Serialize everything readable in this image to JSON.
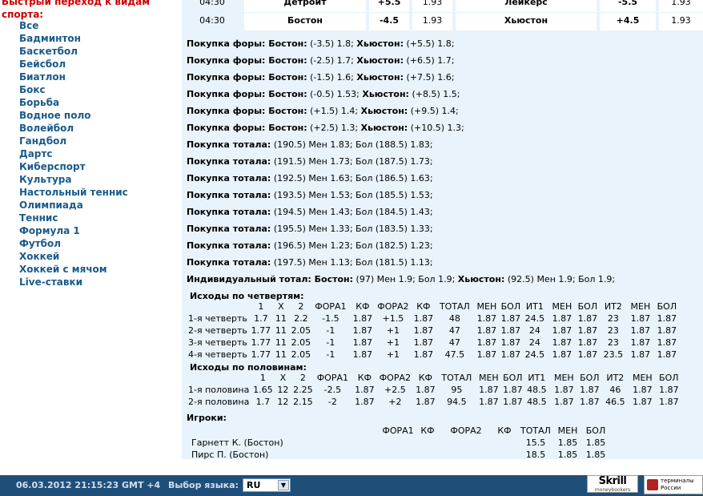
{
  "sidebar": {
    "heading": "Быстрый переход к видам спорта:",
    "items": [
      "Все",
      "Бадминтон",
      "Баскетбол",
      "Бейсбол",
      "Биатлон",
      "Бокс",
      "Борьба",
      "Водное поло",
      "Волейбол",
      "Гандбол",
      "Дартс",
      "Киберспорт",
      "Культура",
      "Настольный теннис",
      "Олимпиада",
      "Теннис",
      "Формула 1",
      "Футбол",
      "Хоккей",
      "Хоккей с мячом",
      "Live-ставки"
    ]
  },
  "matches": [
    {
      "time": "04:30",
      "team1": "Детройт",
      "val1": "+5.5",
      "odd1": "1.93",
      "team2": "Лейкерс",
      "val2": "-5.5",
      "odd2": "1.93"
    },
    {
      "time": "04:30",
      "team1": "Бостон",
      "val1": "-4.5",
      "odd1": "1.93",
      "team2": "Хьюстон",
      "val2": "+4.5",
      "odd2": "1.93"
    }
  ],
  "lines": [
    [
      {
        "b": "Покупка форы: Бостон:"
      },
      {
        "t": " (-3.5) 1.8; "
      },
      {
        "b": "Хьюстон:"
      },
      {
        "t": " (+5.5) 1.8;"
      }
    ],
    [
      {
        "b": "Покупка форы: Бостон:"
      },
      {
        "t": " (-2.5) 1.7; "
      },
      {
        "b": "Хьюстон:"
      },
      {
        "t": " (+6.5) 1.7;"
      }
    ],
    [
      {
        "b": "Покупка форы: Бостон:"
      },
      {
        "t": " (-1.5) 1.6; "
      },
      {
        "b": "Хьюстон:"
      },
      {
        "t": " (+7.5) 1.6;"
      }
    ],
    [
      {
        "b": "Покупка форы: Бостон:"
      },
      {
        "t": " (-0.5) 1.53; "
      },
      {
        "b": "Хьюстон:"
      },
      {
        "t": " (+8.5) 1.5;"
      }
    ],
    [
      {
        "b": "Покупка форы: Бостон:"
      },
      {
        "t": " (+1.5) 1.4; "
      },
      {
        "b": "Хьюстон:"
      },
      {
        "t": " (+9.5) 1.4;"
      }
    ],
    [
      {
        "b": "Покупка форы: Бостон:"
      },
      {
        "t": " (+2.5) 1.3; "
      },
      {
        "b": "Хьюстон:"
      },
      {
        "t": " (+10.5) 1.3;"
      }
    ],
    [
      {
        "b": "Покупка тотала:"
      },
      {
        "t": " (190.5) Мен 1.83; Бол (188.5) 1.83;"
      }
    ],
    [
      {
        "b": "Покупка тотала:"
      },
      {
        "t": " (191.5) Мен 1.73; Бол (187.5) 1.73;"
      }
    ],
    [
      {
        "b": "Покупка тотала:"
      },
      {
        "t": " (192.5) Мен 1.63; Бол (186.5) 1.63;"
      }
    ],
    [
      {
        "b": "Покупка тотала:"
      },
      {
        "t": " (193.5) Мен 1.53; Бол (185.5) 1.53;"
      }
    ],
    [
      {
        "b": "Покупка тотала:"
      },
      {
        "t": " (194.5) Мен 1.43; Бол (184.5) 1.43;"
      }
    ],
    [
      {
        "b": "Покупка тотала:"
      },
      {
        "t": " (195.5) Мен 1.33; Бол (183.5) 1.33;"
      }
    ],
    [
      {
        "b": "Покупка тотала:"
      },
      {
        "t": " (196.5) Мен 1.23; Бол (182.5) 1.23;"
      }
    ],
    [
      {
        "b": "Покупка тотала:"
      },
      {
        "t": " (197.5) Мен 1.13; Бол (181.5) 1.13;"
      }
    ],
    [
      {
        "b": "Индивидуальный тотал: Бостон:"
      },
      {
        "t": " (97) Мен 1.9; Бол 1.9; "
      },
      {
        "b": "Хьюстон:"
      },
      {
        "t": " (92.5) Мен 1.9; Бол 1.9;"
      }
    ]
  ],
  "quarters": {
    "title": "Исходы по четвертям:",
    "headers": [
      "",
      "1",
      "X",
      "2",
      "ФОРА1",
      "КФ",
      "ФОРА2",
      "КФ",
      "ТОТАЛ",
      "МЕН",
      "БОЛ",
      "ИТ1",
      "МЕН",
      "БОЛ",
      "ИТ2",
      "МЕН",
      "БОЛ"
    ],
    "rows": [
      [
        "1-я четверть",
        "1.7",
        "11",
        "2.2",
        "-1.5",
        "1.87",
        "+1.5",
        "1.87",
        "48",
        "1.87",
        "1.87",
        "24.5",
        "1.87",
        "1.87",
        "23",
        "1.87",
        "1.87"
      ],
      [
        "2-я четверть",
        "1.77",
        "11",
        "2.05",
        "-1",
        "1.87",
        "+1",
        "1.87",
        "47",
        "1.87",
        "1.87",
        "24",
        "1.87",
        "1.87",
        "23",
        "1.87",
        "1.87"
      ],
      [
        "3-я четверть",
        "1.77",
        "11",
        "2.05",
        "-1",
        "1.87",
        "+1",
        "1.87",
        "47",
        "1.87",
        "1.87",
        "24",
        "1.87",
        "1.87",
        "23",
        "1.87",
        "1.87"
      ],
      [
        "4-я четверть",
        "1.77",
        "11",
        "2.05",
        "-1",
        "1.87",
        "+1",
        "1.87",
        "47.5",
        "1.87",
        "1.87",
        "24.5",
        "1.87",
        "1.87",
        "23.5",
        "1.87",
        "1.87"
      ]
    ]
  },
  "halves": {
    "title": "Исходы по половинам:",
    "headers": [
      "",
      "1",
      "X",
      "2",
      "ФОРА1",
      "КФ",
      "ФОРА2",
      "КФ",
      "ТОТАЛ",
      "МЕН",
      "БОЛ",
      "ИТ1",
      "МЕН",
      "БОЛ",
      "ИТ2",
      "МЕН",
      "БОЛ"
    ],
    "rows": [
      [
        "1-я половина",
        "1.65",
        "12",
        "2.25",
        "-2.5",
        "1.87",
        "+2.5",
        "1.87",
        "95",
        "1.87",
        "1.87",
        "48.5",
        "1.87",
        "1.87",
        "46",
        "1.87",
        "1.87"
      ],
      [
        "2-я половина",
        "1.7",
        "12",
        "2.15",
        "-2",
        "1.87",
        "+2",
        "1.87",
        "94.5",
        "1.87",
        "1.87",
        "48.5",
        "1.87",
        "1.87",
        "46.5",
        "1.87",
        "1.87"
      ]
    ]
  },
  "players": {
    "title": "Игроки:",
    "headers": [
      "",
      "ФОРА1",
      "КФ",
      "ФОРА2",
      "КФ",
      "ТОТАЛ",
      "МЕН",
      "БОЛ"
    ],
    "rows": [
      [
        "Гарнетт К. (Бостон)",
        "",
        "",
        "",
        "",
        "15.5",
        "1.85",
        "1.85"
      ],
      [
        "Пирс П. (Бостон)",
        "",
        "",
        "",
        "",
        "18.5",
        "1.85",
        "1.85"
      ]
    ]
  },
  "footer": {
    "datetime": "06.03.2012  21:15:23  GMT +4",
    "language_label": "Выбор языка:",
    "language_value": "RU",
    "skrill_main": "Skrill",
    "skrill_sub": "moneybookers",
    "terminal_line1": "терминалы",
    "terminal_line2": "России"
  }
}
